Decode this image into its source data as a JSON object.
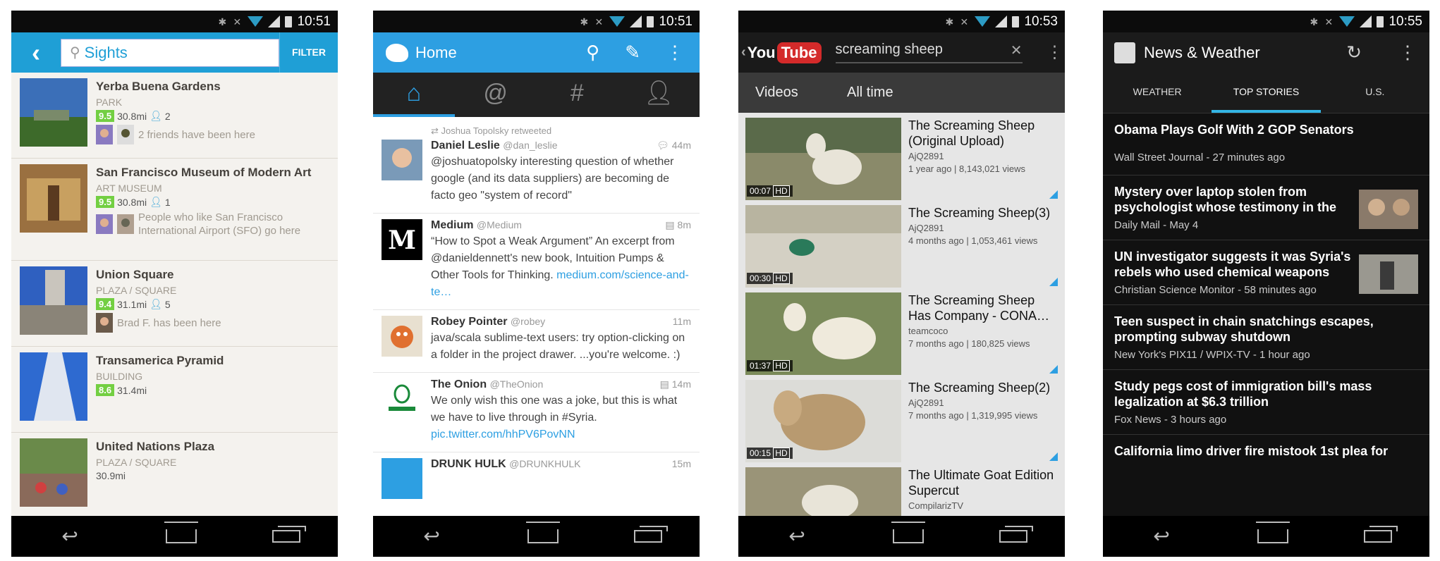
{
  "status_times": [
    "10:51",
    "10:51",
    "10:53",
    "10:55"
  ],
  "foursquare": {
    "search": "Sights",
    "filter": "FILTER",
    "items": [
      {
        "name": "Yerba Buena Gardens",
        "category": "PARK",
        "score": "9.5",
        "distance": "30.8mi",
        "people": "2",
        "friends": "2 friends have been here"
      },
      {
        "name": "San Francisco Museum of Modern Art",
        "category": "ART MUSEUM",
        "score": "9.5",
        "distance": "30.8mi",
        "people": "1",
        "friends": "People who like San Francisco International Airport (SFO) go here"
      },
      {
        "name": "Union Square",
        "category": "PLAZA / SQUARE",
        "score": "9.4",
        "distance": "31.1mi",
        "people": "5",
        "friends": "Brad F. has been here"
      },
      {
        "name": "Transamerica Pyramid",
        "category": "BUILDING",
        "score": "8.6",
        "distance": "31.4mi"
      },
      {
        "name": "United Nations Plaza",
        "category": "PLAZA / SQUARE",
        "distance": "30.9mi"
      }
    ]
  },
  "twitter": {
    "title": "Home",
    "retweet_context": "Joshua Topolsky retweeted",
    "tweets": [
      {
        "name": "Daniel Leslie",
        "handle": "@dan_leslie",
        "time": "44m",
        "text": "@joshuatopolsky interesting question of whether google (and its data suppliers) are becoming de facto geo \"system of record\""
      },
      {
        "name": "Medium",
        "handle": "@Medium",
        "time": "8m",
        "text": "“How to Spot a Weak Argument” An excerpt from @danieldennett's new book, Intuition Pumps & Other Tools for Thinking.",
        "link": "medium.com/science-and-te…"
      },
      {
        "name": "Robey Pointer",
        "handle": "@robey",
        "time": "11m",
        "text": "java/scala sublime-text users: try option-clicking on a folder in the project drawer. ...you're welcome. :)"
      },
      {
        "name": "The Onion",
        "handle": "@TheOnion",
        "time": "14m",
        "text": "We only wish this one was a joke, but this is what we have to live through in #Syria.",
        "link": "pic.twitter.com/hhPV6PovNN"
      },
      {
        "name": "DRUNK HULK",
        "handle": "@DRUNKHULK",
        "time": "15m"
      }
    ]
  },
  "youtube": {
    "logo_you": "You",
    "logo_tube": "Tube",
    "query": "screaming sheep",
    "filter1": "Videos",
    "filter2": "All time",
    "videos": [
      {
        "title": "The Screaming Sheep (Original Upload)",
        "channel": "AjQ2891",
        "meta": "1 year ago | 8,143,021 views",
        "duration": "00:07",
        "hd": "HD"
      },
      {
        "title": "The Screaming Sheep(3)",
        "channel": "AjQ2891",
        "meta": "4 months ago | 1,053,461 views",
        "duration": "00:30",
        "hd": "HD"
      },
      {
        "title": "The Screaming Sheep Has Company - CONA…",
        "channel": "teamcoco",
        "meta": "7 months ago | 180,825 views",
        "duration": "01:37",
        "hd": "HD"
      },
      {
        "title": "The Screaming Sheep(2)",
        "channel": "AjQ2891",
        "meta": "7 months ago | 1,319,995 views",
        "duration": "00:15",
        "hd": "HD"
      },
      {
        "title": "The Ultimate Goat Edition Supercut",
        "channel": "CompilarizTV"
      }
    ]
  },
  "news": {
    "title": "News & Weather",
    "tabs": [
      "WEATHER",
      "TOP STORIES",
      "U.S."
    ],
    "stories": [
      {
        "headline": "Obama Plays Golf With 2 GOP Senators",
        "source": "Wall Street Journal - 27 minutes ago"
      },
      {
        "headline": "Mystery over laptop stolen from psychologist whose testimony in the",
        "source": "Daily Mail - May 4"
      },
      {
        "headline": "UN investigator suggests it was Syria's rebels who used chemical weapons",
        "source": "Christian Science Monitor - 58 minutes ago"
      },
      {
        "headline": "Teen suspect in chain snatchings escapes, prompting subway shutdown",
        "source": "New York's PIX11 / WPIX-TV - 1 hour ago"
      },
      {
        "headline": "Study pegs cost of immigration bill's mass legalization at $6.3 trillion",
        "source": "Fox News - 3 hours ago"
      },
      {
        "headline": "California limo driver fire mistook 1st plea for"
      }
    ]
  }
}
